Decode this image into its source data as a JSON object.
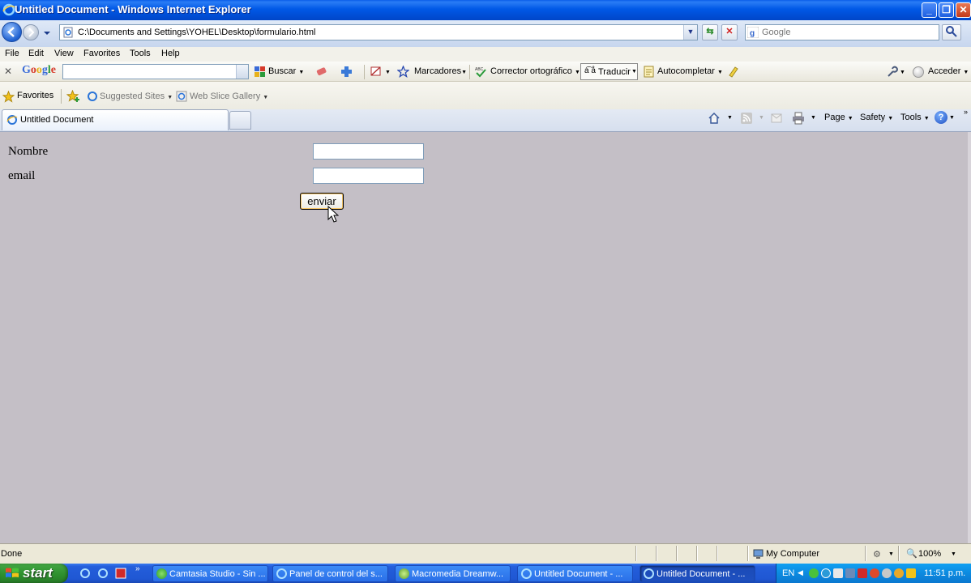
{
  "window": {
    "title": "Untitled Document - Windows Internet Explorer"
  },
  "address_bar": {
    "url": "C:\\Documents and Settings\\YOHEL\\Desktop\\formulario.html"
  },
  "search_box": {
    "placeholder": "Google"
  },
  "menu": {
    "items": [
      "File",
      "Edit",
      "View",
      "Favorites",
      "Tools",
      "Help"
    ]
  },
  "google_toolbar": {
    "logo": "Google",
    "buscar": "Buscar",
    "marcadores": "Marcadores",
    "corrector": "Corrector ortográfico",
    "traducir": "Traducir",
    "autocompletar": "Autocompletar",
    "acceder": "Acceder"
  },
  "favorites_bar": {
    "favorites": "Favorites",
    "suggested_sites": "Suggested Sites",
    "web_slice_gallery": "Web Slice Gallery"
  },
  "tab": {
    "title": "Untitled Document"
  },
  "command_bar": {
    "page": "Page",
    "safety": "Safety",
    "tools": "Tools"
  },
  "form": {
    "nombre_label": "Nombre",
    "email_label": "email",
    "submit_label": "enviar",
    "nombre_value": "",
    "email_value": ""
  },
  "status_bar": {
    "status": "Done",
    "zone": "My Computer",
    "zoom": "100%"
  },
  "taskbar": {
    "start": "start",
    "tasks": [
      "Camtasia Studio - Sin ...",
      "Panel de control del s...",
      "Macromedia Dreamw...",
      "Untitled Document - ...",
      "Untitled Document - ..."
    ],
    "language": "EN",
    "clock": "11:51 p.m."
  },
  "colors": {
    "titlebar": "#0058e6",
    "content_bg": "#c4bfc6",
    "taskbar": "#245edb",
    "start": "#2d8e2d"
  }
}
